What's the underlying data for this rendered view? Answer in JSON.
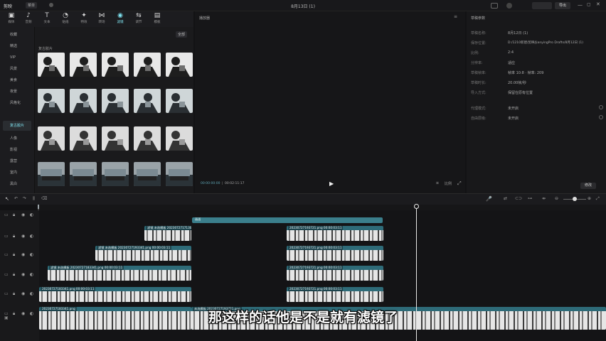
{
  "titlebar": {
    "app_name": "剪映",
    "menu": "菜单",
    "project_title": "8月13日 (1)",
    "buttons": [
      "",
      "",
      "",
      "导出"
    ]
  },
  "toolbar": {
    "items": [
      {
        "label": "媒体",
        "icon": "media-icon"
      },
      {
        "label": "音频",
        "icon": "audio-icon"
      },
      {
        "label": "文本",
        "icon": "text-icon"
      },
      {
        "label": "贴纸",
        "icon": "sticker-icon"
      },
      {
        "label": "特效",
        "icon": "effects-icon"
      },
      {
        "label": "转场",
        "icon": "transition-icon"
      },
      {
        "label": "滤镜",
        "icon": "filter-icon"
      },
      {
        "label": "调节",
        "icon": "adjust-icon"
      },
      {
        "label": "模板",
        "icon": "template-icon"
      }
    ]
  },
  "sidebar": {
    "items": [
      "收藏",
      "精选",
      "VIP",
      "风景",
      "美食",
      "夜景",
      "风格化",
      "复古胶片",
      "人像",
      "影视",
      "露营",
      "室内",
      "黑白"
    ]
  },
  "library": {
    "filter_button": "全部",
    "section1_title": "",
    "section2_title": "复古胶片",
    "row1_labels": [
      "",
      "",
      "",
      "",
      ""
    ],
    "thumbs_row2_labels": [
      "",
      "",
      "",
      "",
      ""
    ],
    "thumbs_row3_labels": [
      "",
      "",
      "",
      "",
      ""
    ],
    "thumbs_row4_labels": [
      "",
      "",
      "",
      "",
      ""
    ],
    "thumbs_row5_labels": [
      "",
      "",
      "",
      "",
      ""
    ]
  },
  "player": {
    "title": "播放器",
    "time_current": "00:00:00:00",
    "time_total": "00:02:11:17",
    "ratio_button": "比例"
  },
  "details": {
    "title": "草稿参数",
    "rows": [
      {
        "key": "草稿名称:",
        "value": "8月12日 (1)"
      },
      {
        "key": "保存位置:",
        "value": "D:/1210新建/剪映/JianyingPro Drafts/8月12日 (1)"
      },
      {
        "key": "比例:",
        "value": "2:4"
      },
      {
        "key": "分辨率:",
        "value": "适应"
      },
      {
        "key": "草稿帧率:",
        "value": "帧率 10:8 · 帧率: 209"
      },
      {
        "key": "草稿时长:",
        "value": "20.00帧/秒"
      },
      {
        "key": "导入方式:",
        "value": "保留在原有位置"
      },
      {
        "key": "代理模式:",
        "value": "未开启"
      },
      {
        "key": "自由层级:",
        "value": "未开启"
      }
    ],
    "modify_button": "修改"
  },
  "timeline": {
    "ruler": [
      "",
      "",
      "",
      "",
      "",
      "",
      "",
      "",
      "",
      "",
      "",
      "",
      "",
      ""
    ],
    "clip_texts": [
      "画面",
      "滤镜  未选模板  20230727171307.png  00:00:03:11",
      "20230727193721.png  00:00:03:11",
      "滤镜  未选模板  20230727193341.png  00:00:03:11",
      "20230727193721.png  00:00:03:11",
      "滤镜  未选模板  20230727183341.png  00:00:03:11",
      "20230727193721.png  00:00:03:11",
      "20230727183341.png  00:00:03:11",
      "20230727193721.png  00:00:03:11",
      "20230727183341.png",
      "未选模板  20230727193721.png"
    ]
  },
  "subtitle": "那这样的话他是不是就有滤镜了"
}
